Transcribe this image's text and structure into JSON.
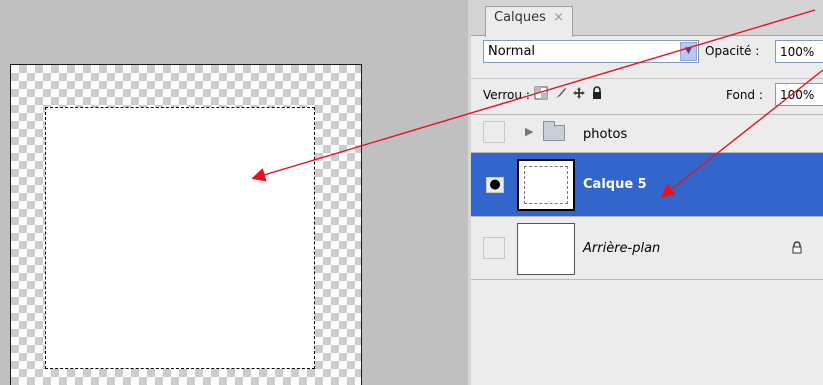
{
  "panel": {
    "tab_label": "Calques",
    "tab_close": "×",
    "blend_mode": "Normal",
    "opacity_label": "Opacité :",
    "opacity_value": "100%",
    "lock_label": "Verrou :",
    "fill_label": "Fond :",
    "fill_value": "100%"
  },
  "icons": {
    "blend_dropdown": "chevron-down-icon",
    "lock_transparent": "checkerboard-lock-icon",
    "lock_pixels": "brush-lock-icon",
    "lock_position": "move-lock-icon",
    "lock_all": "padlock-icon",
    "visibility": "eye-icon",
    "folder": "folder-icon",
    "expand": "triangle-right-icon",
    "layer_locked": "padlock-icon"
  },
  "layers": [
    {
      "name": "photos",
      "type": "group",
      "visible": false,
      "selected": false
    },
    {
      "name": "Calque 5",
      "type": "layer",
      "visible": true,
      "selected": true
    },
    {
      "name": "Arrière-plan",
      "type": "background",
      "visible": false,
      "selected": false,
      "locked": true
    }
  ],
  "colors": {
    "selected_row": "#3366cc",
    "arrow": "#e8121d"
  }
}
